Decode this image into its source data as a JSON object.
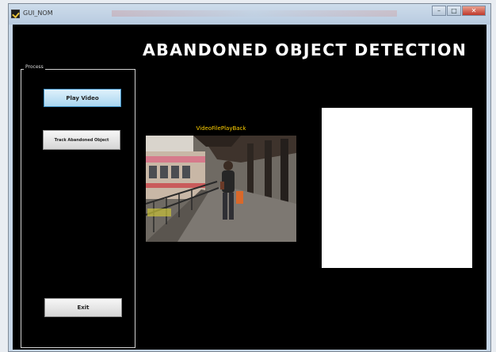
{
  "window": {
    "title": "GUI_NOM",
    "controls": {
      "minimize": "–",
      "maximize": "□",
      "close": "✕"
    }
  },
  "heading": "ABANDONED OBJECT DETECTION",
  "process_panel": {
    "legend": "Process",
    "buttons": {
      "play": "Play Video",
      "track": "Track Abandoned Object",
      "exit": "Exit"
    }
  },
  "video": {
    "label": "VideoFilePlayBack"
  },
  "colors": {
    "background": "#000000",
    "accent_label": "#ffd000",
    "active_button": "#a9d6f0"
  }
}
